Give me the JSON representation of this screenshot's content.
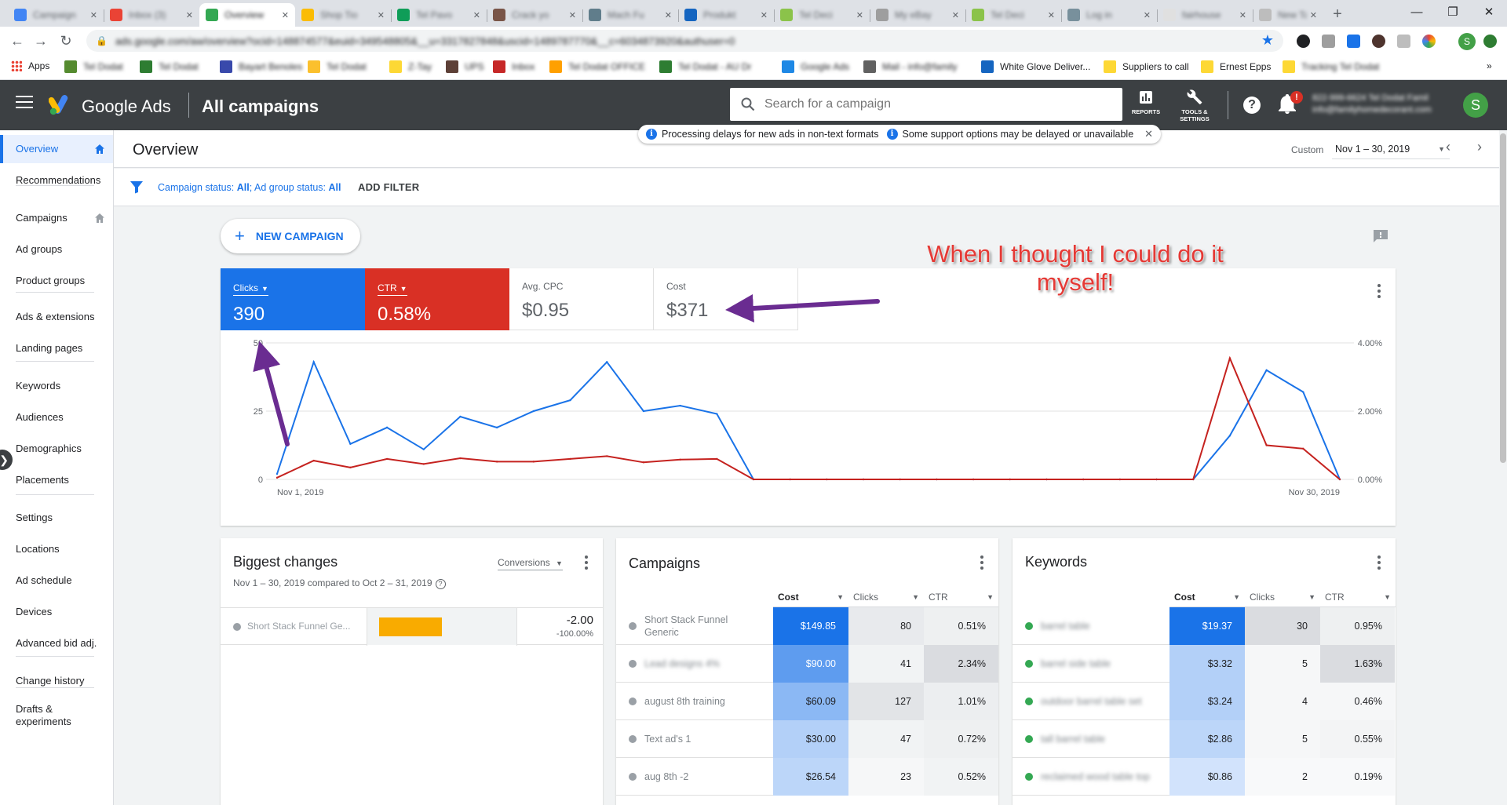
{
  "browser": {
    "tabs": [
      {
        "label": "Campaign",
        "color": "#4285f4"
      },
      {
        "label": "Inbox (3)",
        "color": "#ea4335"
      },
      {
        "label": "Overview",
        "color": "#34a853"
      },
      {
        "label": "Shop Tio",
        "color": "#fbbc04"
      },
      {
        "label": "Tel Pavo",
        "color": "#0f9d58"
      },
      {
        "label": "Crack yo",
        "color": "#795548"
      },
      {
        "label": "Mach Fu",
        "color": "#607d8b"
      },
      {
        "label": "Produkt",
        "color": "#1565c0"
      },
      {
        "label": "Tel Deci",
        "color": "#8bc34a"
      },
      {
        "label": "My eBay",
        "color": "#9e9e9e"
      },
      {
        "label": "Tel Deci",
        "color": "#8bc34a"
      },
      {
        "label": "Log in",
        "color": "#78909c"
      },
      {
        "label": "fairhouse",
        "color": "#e0e0e0"
      },
      {
        "label": "New Tab",
        "color": "#bdbdbd"
      }
    ],
    "url": "ads.google.com/aw/overview?ocid=148874577&euid=349548805&__u=3317827848&uscid=1489787770&__c=6034873920&authuser=0",
    "bookmarks": [
      {
        "label": "Apps",
        "blur": false,
        "color": ""
      },
      {
        "label": "Tel Dodat",
        "blur": true,
        "color": "#558b2f"
      },
      {
        "label": "Tel Dodat",
        "blur": true,
        "color": "#2e7d32"
      },
      {
        "label": "Bayart Benoles",
        "blur": true,
        "color": "#3949ab"
      },
      {
        "label": "Tel Dodat",
        "blur": true,
        "color": "#fbc02d"
      },
      {
        "label": "Z-Tay",
        "blur": true,
        "color": "#fdd835"
      },
      {
        "label": "UPS",
        "blur": true,
        "color": "#5d4037"
      },
      {
        "label": "Inbox",
        "blur": true,
        "color": "#c62828"
      },
      {
        "label": "Tel Dodat OFFICE",
        "blur": true,
        "color": "#ffa000"
      },
      {
        "label": "Tel Dodat - AU Dr",
        "blur": true,
        "color": "#2e7d32"
      },
      {
        "label": "Google Ads",
        "blur": true,
        "color": "#1e88e5"
      },
      {
        "label": "Mail - info@family",
        "blur": true,
        "color": "#616161"
      },
      {
        "label": "White Glove Deliver...",
        "blur": false,
        "color": "#1565c0"
      },
      {
        "label": "Suppliers to call",
        "blur": false,
        "color": "#fdd835"
      },
      {
        "label": "Ernest Epps",
        "blur": false,
        "color": "#fdd835"
      },
      {
        "label": "Tracking Tel Dodat",
        "blur": true,
        "color": "#fdd835"
      }
    ]
  },
  "header": {
    "product": "Google Ads",
    "page_title": "All campaigns",
    "search_placeholder": "Search for a campaign",
    "reports_label": "REPORTS",
    "tools_label_1": "TOOLS &",
    "tools_label_2": "SETTINGS",
    "bell_badge": "!",
    "account_line1": "822-999-6624 Tel Dodat Famil",
    "account_line2": "info@familyhomedecorant.com",
    "avatar_letter": "S"
  },
  "sidebar": {
    "items": [
      {
        "label": "Overview",
        "active": true,
        "home": true
      },
      {
        "label": "Recommendations",
        "active": false,
        "home": false
      },
      {
        "label": "Campaigns",
        "active": false,
        "home": true
      },
      {
        "label": "Ad groups",
        "active": false,
        "home": false
      },
      {
        "label": "Product groups",
        "active": false,
        "home": false
      },
      {
        "label": "Ads & extensions",
        "active": false,
        "home": false
      },
      {
        "label": "Landing pages",
        "active": false,
        "home": false
      },
      {
        "label": "Keywords",
        "active": false,
        "home": false
      },
      {
        "label": "Audiences",
        "active": false,
        "home": false
      },
      {
        "label": "Demographics",
        "active": false,
        "home": false
      },
      {
        "label": "Placements",
        "active": false,
        "home": false
      },
      {
        "label": "Settings",
        "active": false,
        "home": false
      },
      {
        "label": "Locations",
        "active": false,
        "home": false
      },
      {
        "label": "Ad schedule",
        "active": false,
        "home": false
      },
      {
        "label": "Devices",
        "active": false,
        "home": false
      },
      {
        "label": "Advanced bid adj.",
        "active": false,
        "home": false
      },
      {
        "label": "Change history",
        "active": false,
        "home": false
      },
      {
        "label": "Drafts &\nexperiments",
        "active": false,
        "home": false
      }
    ]
  },
  "topbar": {
    "title": "Overview",
    "notice1": "Processing delays for new ads in non-text formats",
    "notice2": "Some support options may be delayed or unavailable",
    "date_custom": "Custom",
    "date_range": "Nov 1 – 30, 2019"
  },
  "filter": {
    "status1_label": "Campaign status: ",
    "status1_value": "All",
    "status2_label": "; Ad group status: ",
    "status2_value": "All",
    "add_filter": "ADD FILTER"
  },
  "main": {
    "new_campaign": "NEW CAMPAIGN",
    "metrics": [
      {
        "label": "Clicks",
        "value": "390",
        "state": "blue",
        "dropdown": true
      },
      {
        "label": "CTR",
        "value": "0.58%",
        "state": "red",
        "dropdown": true
      },
      {
        "label": "Avg. CPC",
        "value": "$0.95",
        "state": "none",
        "dropdown": false
      },
      {
        "label": "Cost",
        "value": "$371",
        "state": "none",
        "dropdown": false
      }
    ],
    "annotation": "When I thought I could do it myself!"
  },
  "chart_data": {
    "type": "line",
    "x_start_label": "Nov 1, 2019",
    "x_end_label": "Nov 30, 2019",
    "x": [
      1,
      2,
      3,
      4,
      5,
      6,
      7,
      8,
      9,
      10,
      11,
      12,
      13,
      14,
      15,
      16,
      17,
      18,
      19,
      20,
      21,
      22,
      23,
      24,
      25,
      26,
      27,
      28,
      29,
      30
    ],
    "ylim_left": [
      0,
      50
    ],
    "yticks_left": [
      "0",
      "25",
      "50"
    ],
    "ylim_right": [
      0,
      4
    ],
    "yticks_right": [
      "0.00%",
      "2.00%",
      "4.00%"
    ],
    "grid": true,
    "series": [
      {
        "name": "Clicks",
        "axis": "left",
        "color": "#1a73e8",
        "values": [
          2,
          43,
          13,
          19,
          11,
          23,
          19,
          25,
          29,
          43,
          25,
          27,
          24,
          0,
          0,
          0,
          0,
          0,
          0,
          0,
          0,
          0,
          0,
          0,
          0,
          0,
          16,
          40,
          32,
          0
        ]
      },
      {
        "name": "CTR",
        "axis": "right",
        "color": "#c5221f",
        "values": [
          0.05,
          0.55,
          0.35,
          0.6,
          0.45,
          0.62,
          0.52,
          0.52,
          0.6,
          0.68,
          0.5,
          0.58,
          0.6,
          0,
          0,
          0,
          0,
          0,
          0,
          0,
          0,
          0,
          0,
          0,
          0,
          0,
          3.55,
          1.0,
          0.9,
          0
        ]
      }
    ]
  },
  "biggest_changes": {
    "title": "Biggest changes",
    "metric": "Conversions",
    "subtitle": "Nov 1 – 30, 2019 compared to Oct 2 – 31, 2019",
    "row_name": "Short Stack Funnel Ge...",
    "row_value": "-2.00",
    "row_pct": "-100.00%"
  },
  "campaigns_card": {
    "title": "Campaigns",
    "headers": [
      "Cost",
      "Clicks",
      "CTR"
    ],
    "rows": [
      {
        "name": "Short Stack Funnel Generic",
        "blur": false,
        "cost": "$149.85",
        "clicks": "80",
        "ctr": "0.51%",
        "shade": "#1a73e8"
      },
      {
        "name": "Lead designs 4%",
        "blur": true,
        "cost": "$90.00",
        "clicks": "41",
        "ctr": "2.34%",
        "shade": "#5e9cef"
      },
      {
        "name": "august 8th training",
        "blur": false,
        "cost": "$60.09",
        "clicks": "127",
        "ctr": "1.01%",
        "shade": "#8bb8f4"
      },
      {
        "name": "Text ad's 1",
        "blur": false,
        "cost": "$30.00",
        "clicks": "47",
        "ctr": "0.72%",
        "shade": "#b3d0f8"
      },
      {
        "name": "aug 8th -2",
        "blur": false,
        "cost": "$26.54",
        "clicks": "23",
        "ctr": "0.52%",
        "shade": "#bcd6f9"
      }
    ],
    "clicks_shades": [
      "#e8eaed",
      "#f1f3f4",
      "#e2e4e7",
      "#f1f3f4",
      "#f6f7f8"
    ],
    "ctr_shades": [
      "#eef0f1",
      "#dadce0",
      "#eceef0",
      "#eef0f1",
      "#f1f3f4"
    ]
  },
  "keywords_card": {
    "title": "Keywords",
    "headers": [
      "Cost",
      "Clicks",
      "CTR"
    ],
    "rows": [
      {
        "name": "barrel table",
        "cost": "$19.37",
        "clicks": "30",
        "ctr": "0.95%",
        "shade": "#1a73e8"
      },
      {
        "name": "barrel side table",
        "cost": "$3.32",
        "clicks": "5",
        "ctr": "1.63%",
        "shade": "#b3d0f8"
      },
      {
        "name": "outdoor barrel table set",
        "cost": "$3.24",
        "clicks": "4",
        "ctr": "0.46%",
        "shade": "#b3d0f8"
      },
      {
        "name": "tall barrel table",
        "cost": "$2.86",
        "clicks": "5",
        "ctr": "0.55%",
        "shade": "#bcd6f9"
      },
      {
        "name": "reclaimed wood table top",
        "cost": "$0.86",
        "clicks": "2",
        "ctr": "0.19%",
        "shade": "#d2e3fc"
      }
    ],
    "clicks_shades": [
      "#dadce0",
      "#f6f7f8",
      "#f6f7f8",
      "#f6f7f8",
      "#f8f9fa"
    ],
    "ctr_shades": [
      "#eef0f1",
      "#dadce0",
      "#f6f7f8",
      "#f3f4f5",
      "#f8f9fa"
    ]
  }
}
